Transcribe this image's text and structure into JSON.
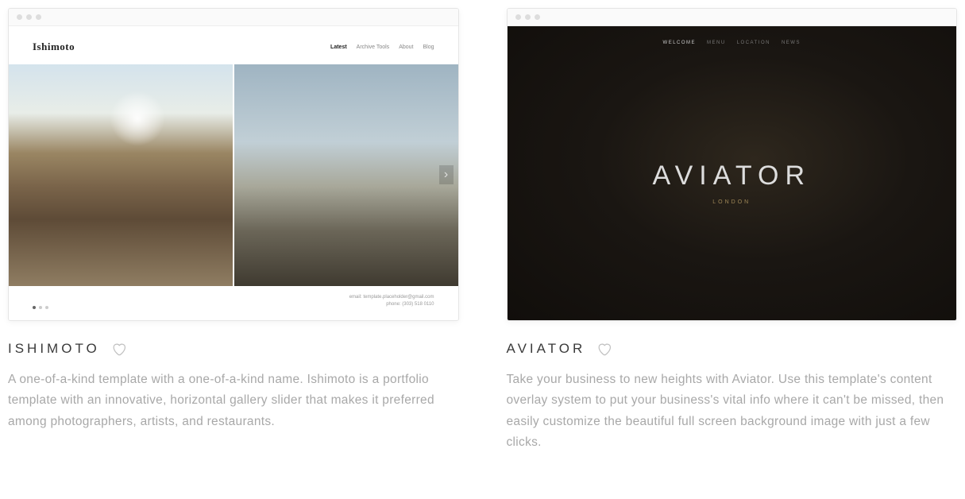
{
  "templates": [
    {
      "name": "ISHIMOTO",
      "description": "A one-of-a-kind template with a one-of-a-kind name. Ishimoto is a portfolio template with an innovative, horizontal gallery slider that makes it preferred among photographers, artists, and restaurants.",
      "preview": {
        "brand": "Ishimoto",
        "nav": [
          "Latest",
          "Archive Tools",
          "About",
          "Blog"
        ],
        "contact_email": "email: template.placeholder@gmail.com",
        "contact_phone": "phone: (303) 518 0110"
      }
    },
    {
      "name": "AVIATOR",
      "description": "Take your business to new heights with Aviator. Use this template's content overlay system to put your business's vital info where it can't be missed, then easily customize the beautiful full screen background image with just a few clicks.",
      "preview": {
        "nav": [
          "WELCOME",
          "MENU",
          "LOCATION",
          "NEWS"
        ],
        "brand": "AVIATOR",
        "city": "LONDON"
      }
    }
  ]
}
